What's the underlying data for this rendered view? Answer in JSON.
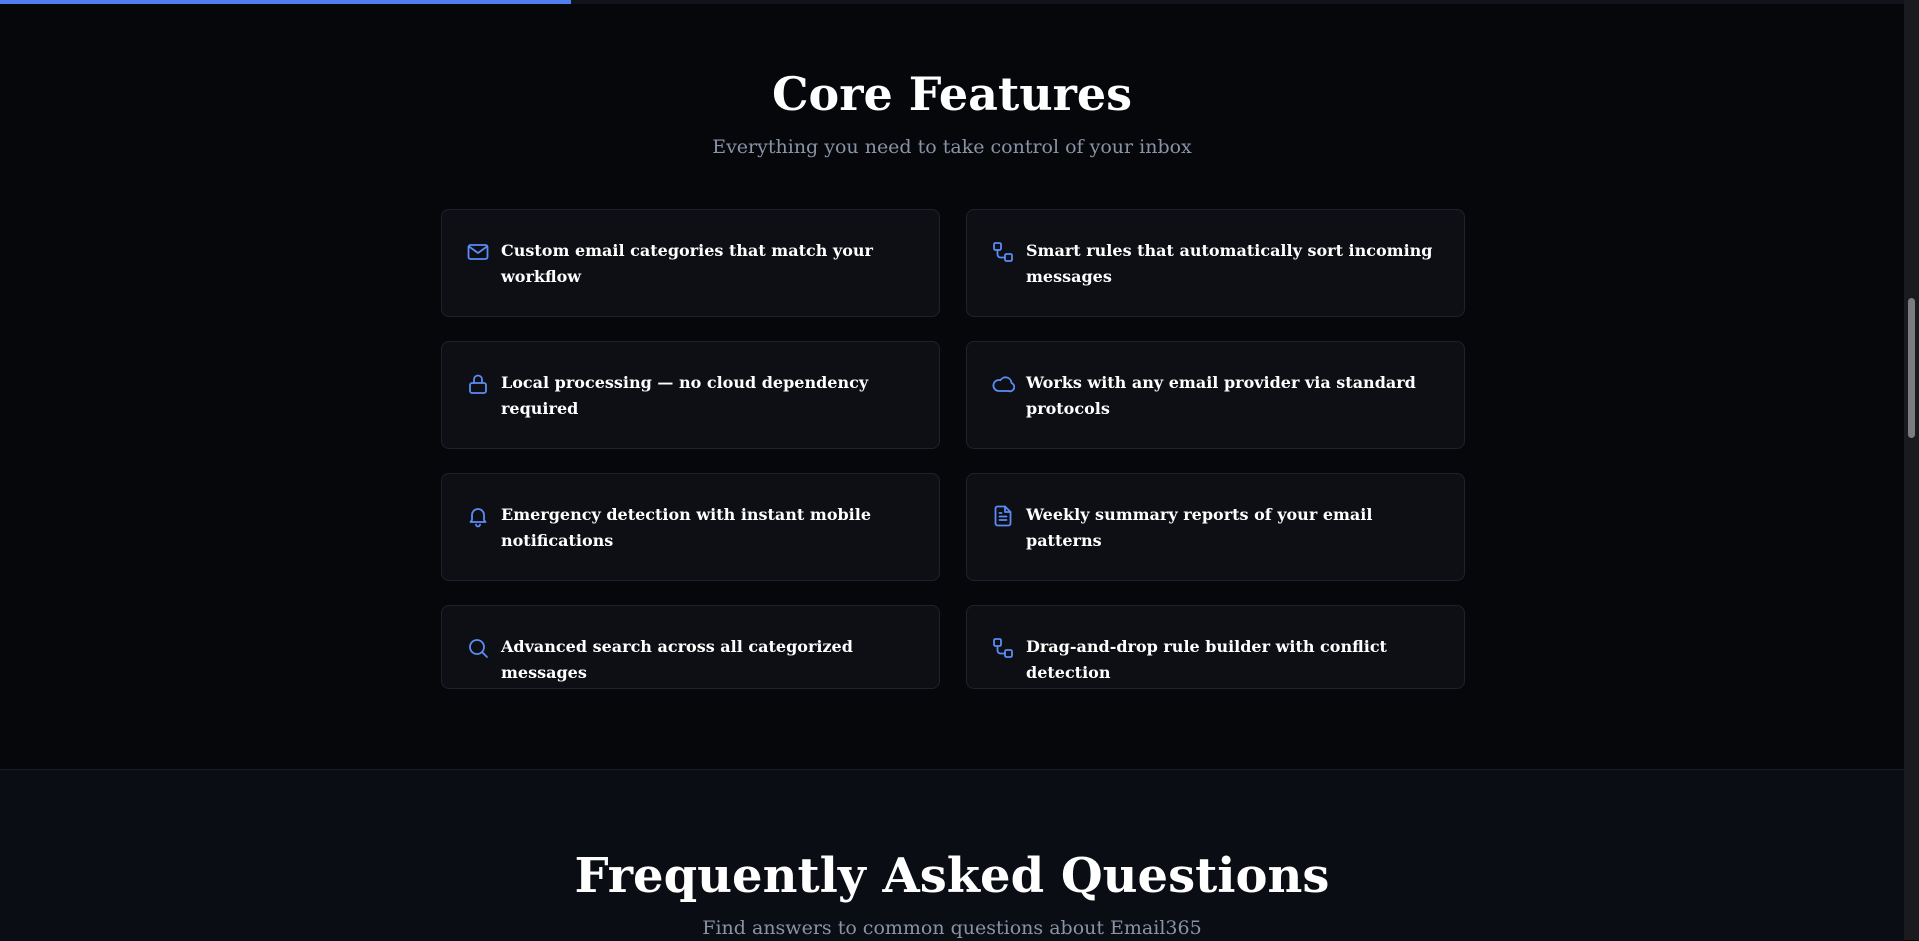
{
  "progress": {
    "fraction": 0.3,
    "color": "#4f7ff0"
  },
  "features": {
    "title": "Core Features",
    "subtitle": "Everything you need to take control of your inbox",
    "items": [
      {
        "icon": "mail-icon",
        "text": "Custom email categories that match your workflow"
      },
      {
        "icon": "workflow-icon",
        "text": "Smart rules that automatically sort incoming messages"
      },
      {
        "icon": "lock-icon",
        "text": "Local processing — no cloud dependency required"
      },
      {
        "icon": "cloud-icon",
        "text": "Works with any email provider via standard protocols"
      },
      {
        "icon": "bell-icon",
        "text": "Emergency detection with instant mobile notifications"
      },
      {
        "icon": "document-icon",
        "text": "Weekly summary reports of your email patterns"
      },
      {
        "icon": "search-icon",
        "text": "Advanced search across all categorized messages"
      },
      {
        "icon": "workflow-icon",
        "text": "Drag-and-drop rule builder with conflict detection"
      }
    ]
  },
  "faq": {
    "title": "Frequently Asked Questions",
    "subtitle": "Find answers to common questions about Email365"
  },
  "colors": {
    "accent": "#5b8cf5",
    "background": "#05070b",
    "card": "#0d0f15"
  }
}
